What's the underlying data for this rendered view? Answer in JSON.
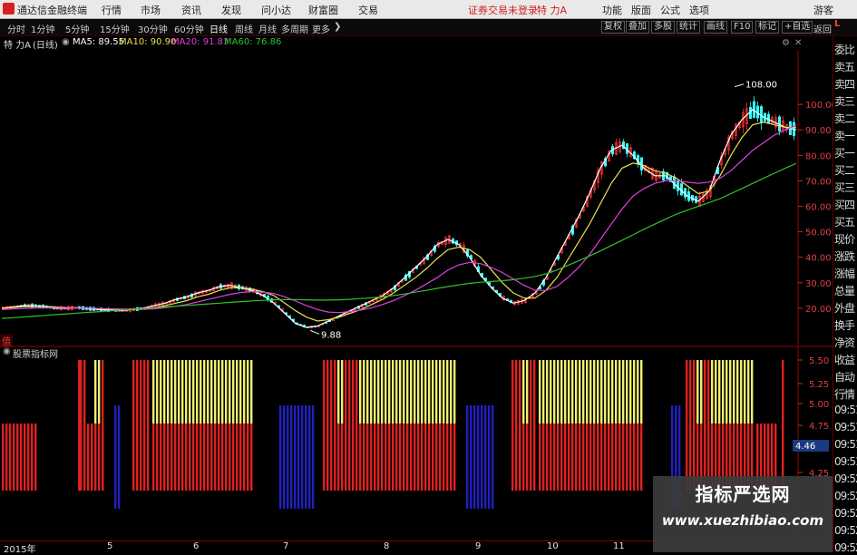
{
  "menubar": {
    "app_name": "通达信金融终端",
    "items": [
      "行情",
      "市场",
      "资讯",
      "发现",
      "问小达",
      "财富圈",
      "交易"
    ],
    "broker_status": "证券交易未登录",
    "stock_title": "特 力A",
    "right_items": [
      "功能",
      "版面",
      "公式",
      "选项"
    ],
    "guest": "游客"
  },
  "toolbar": {
    "timeframes": [
      "分时",
      "1分钟",
      "5分钟",
      "15分钟",
      "30分钟",
      "60分钟",
      "日线",
      "周线",
      "月线",
      "多周期",
      "更多"
    ],
    "active_timeframe": "日线",
    "buttons": [
      "复权",
      "叠加",
      "多股",
      "统计",
      "画线",
      "F10",
      "标记",
      "+自选"
    ],
    "back": "返回"
  },
  "info": {
    "stock": "特 力A",
    "period": "(日线)",
    "ma5": "MA5: 89.55",
    "ma10": "MA10: 90.90",
    "ma20": "MA20: 91.83",
    "ma60": "MA60: 76.86"
  },
  "price_axis": {
    "labels": [
      "100.00",
      "90.00",
      "80.00",
      "70.00",
      "60.00",
      "50.00",
      "40.00",
      "30.00",
      "20.00"
    ],
    "ticks": [
      100,
      90,
      80,
      70,
      60,
      50,
      40,
      30,
      20
    ],
    "corner": "L"
  },
  "annotations": {
    "high": "108.00",
    "low": "9.88"
  },
  "sub_panel": {
    "title": "股票指标网",
    "marker": "值",
    "axis_labels": [
      "5.50",
      "5.25",
      "5.00",
      "4.75",
      "4.25"
    ],
    "current_value": "4.46"
  },
  "right_panel": {
    "items": [
      "委比",
      "卖五",
      "卖四",
      "卖三",
      "卖二",
      "卖一",
      "买一",
      "买二",
      "买三",
      "买四",
      "买五",
      "现价",
      "涨跌",
      "涨幅",
      "总量",
      "外盘",
      "换手",
      "净资",
      "收益",
      "自动",
      "行情",
      "09:51",
      "09:51",
      "09:51",
      "09:51",
      "09:52",
      "09:52",
      "09:52",
      "09:52",
      "09:52"
    ]
  },
  "date_axis": {
    "labels": [
      "2015年",
      "5",
      "6",
      "7",
      "8",
      "9",
      "10",
      "11"
    ]
  },
  "watermark": {
    "line1": "指标严选网",
    "line2": "www.xuezhibiao.com"
  },
  "colors": {
    "up": "#ff3030",
    "down": "#33ffff",
    "ma5": "#ffffff",
    "ma10": "#e8e050",
    "ma20": "#e040e0",
    "ma60": "#30c030",
    "bar_red": "#e02020",
    "bar_yellow": "#f0f070",
    "bar_blue": "#2020c0"
  },
  "chart_data": {
    "type": "line",
    "y_range": [
      10,
      115
    ],
    "x": [
      0,
      12,
      24,
      36,
      48,
      60,
      72,
      84,
      96,
      108,
      120,
      132,
      144,
      156,
      168,
      180,
      192,
      204,
      216,
      228,
      240,
      252,
      264,
      276,
      288,
      300,
      312,
      324,
      336,
      348,
      360,
      372,
      384,
      396,
      408,
      420,
      432,
      444,
      456,
      468,
      480,
      492,
      504,
      516,
      528,
      540,
      552,
      564,
      576,
      588,
      600,
      612,
      624,
      636,
      648,
      660,
      672,
      684,
      696,
      708,
      720,
      732,
      744,
      756,
      768,
      780,
      792,
      804,
      816,
      828,
      840,
      852,
      864,
      876
    ],
    "series": [
      {
        "name": "MA5",
        "values": [
          20,
          20.5,
          21,
          21,
          20.5,
          20,
          20,
          20.2,
          19.8,
          19.5,
          19.2,
          19,
          19.5,
          20,
          21,
          22,
          23.5,
          24.5,
          26,
          27,
          28.5,
          29,
          28,
          27,
          25,
          22,
          18,
          14,
          12.5,
          13,
          15,
          17,
          19,
          21,
          23,
          25,
          28,
          32,
          36,
          40,
          45,
          47,
          45,
          40,
          33,
          28,
          24,
          22,
          23,
          26,
          32,
          40,
          48,
          56,
          65,
          75,
          82,
          84,
          80,
          75,
          72,
          72,
          68,
          64,
          62,
          66,
          78,
          88,
          94,
          98,
          95,
          93,
          91,
          90
        ]
      },
      {
        "name": "MA10",
        "values": [
          20,
          20.3,
          20.6,
          20.8,
          20.7,
          20.5,
          20.3,
          20.2,
          20,
          19.8,
          19.6,
          19.4,
          19.5,
          19.7,
          20.2,
          21,
          22,
          23,
          24.5,
          25.5,
          27,
          28,
          28,
          27.5,
          26.5,
          25,
          22,
          19,
          16.5,
          15,
          15.5,
          16.5,
          18,
          19.5,
          21.5,
          23.5,
          26,
          29,
          32,
          35.5,
          39.5,
          43,
          44,
          43,
          40,
          35,
          30,
          26,
          24,
          24,
          27,
          32,
          39,
          46,
          53,
          61,
          69,
          75,
          77,
          76,
          74,
          73,
          71,
          68,
          65,
          66,
          72,
          80,
          87,
          92,
          93,
          92,
          91,
          90.9
        ]
      },
      {
        "name": "MA20",
        "values": [
          19.5,
          19.7,
          19.9,
          20.1,
          20.2,
          20.2,
          20.2,
          20.1,
          20,
          19.9,
          19.8,
          19.7,
          19.6,
          19.6,
          19.8,
          20.2,
          20.8,
          21.5,
          22.5,
          23.5,
          24.5,
          25.5,
          26.2,
          26.5,
          26.3,
          25.8,
          24.5,
          22.8,
          21,
          19.5,
          18.5,
          18.3,
          18.7,
          19.3,
          20.2,
          21.5,
          23,
          25,
          27,
          29.5,
          32,
          35,
          37,
          38,
          37.5,
          36,
          34,
          31.5,
          29,
          27,
          27,
          28.5,
          32,
          36,
          41,
          47,
          53,
          59,
          64,
          67,
          69,
          70,
          70,
          69.5,
          69,
          69.5,
          71,
          74,
          78,
          82,
          85,
          88,
          90,
          91.8
        ]
      },
      {
        "name": "MA60",
        "values": [
          16,
          16.3,
          16.6,
          16.9,
          17.2,
          17.5,
          17.8,
          18.1,
          18.4,
          18.7,
          19,
          19.3,
          19.6,
          19.9,
          20.2,
          20.5,
          20.8,
          21.1,
          21.4,
          21.7,
          22,
          22.3,
          22.6,
          22.9,
          23.1,
          23.3,
          23.4,
          23.4,
          23.3,
          23.2,
          23.2,
          23.3,
          23.5,
          23.8,
          24.1,
          24.5,
          25,
          25.6,
          26.3,
          27,
          27.8,
          28.5,
          29.2,
          29.8,
          30.2,
          30.5,
          30.8,
          31.2,
          31.8,
          32.5,
          33.5,
          35,
          36.8,
          38.6,
          40.5,
          42.5,
          44.6,
          46.7,
          48.8,
          51,
          53,
          55,
          57,
          58.5,
          60,
          61.5,
          63,
          65,
          67,
          69,
          71,
          73,
          75,
          76.86
        ]
      }
    ],
    "annotations": [
      {
        "label": "108.00",
        "value": 108
      },
      {
        "label": "9.88",
        "value": 9.88
      }
    ]
  }
}
